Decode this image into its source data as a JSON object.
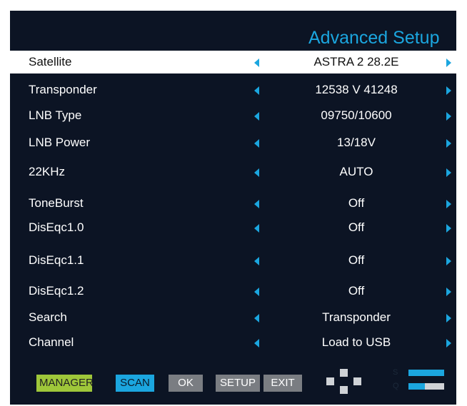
{
  "title": "Advanced Setup",
  "rows": [
    {
      "label": "Satellite",
      "value": "ASTRA 2 28.2E"
    },
    {
      "label": "Transponder",
      "value": "12538 V 41248"
    },
    {
      "label": "LNB Type",
      "value": "09750/10600"
    },
    {
      "label": "LNB Power",
      "value": "13/18V"
    },
    {
      "label": "22KHz",
      "value": "AUTO"
    },
    {
      "label": "ToneBurst",
      "value": "Off"
    },
    {
      "label": "DisEqc1.0",
      "value": "Off"
    },
    {
      "label": "DisEqc1.1",
      "value": "Off"
    },
    {
      "label": "DisEqc1.2",
      "value": "Off"
    },
    {
      "label": "Search",
      "value": "Transponder"
    },
    {
      "label": "Channel",
      "value": "Load to USB"
    }
  ],
  "footer": {
    "manager": "MANAGER",
    "scan": "SCAN",
    "ok": "OK",
    "setup": "SETUP",
    "exit": "EXIT"
  },
  "signal": {
    "strength_label": "S",
    "quality_label": "Q",
    "strength_fraction": 1.0,
    "quality_fraction": 0.45
  },
  "colors": {
    "background": "#0c1424",
    "accent": "#1ba6df",
    "manager_button": "#9fc73a",
    "secondary_button": "#7a7d82"
  },
  "icons": {
    "option_prev": "left-arrow-icon",
    "option_next": "right-arrow-icon",
    "dpad": "dpad-icon"
  }
}
